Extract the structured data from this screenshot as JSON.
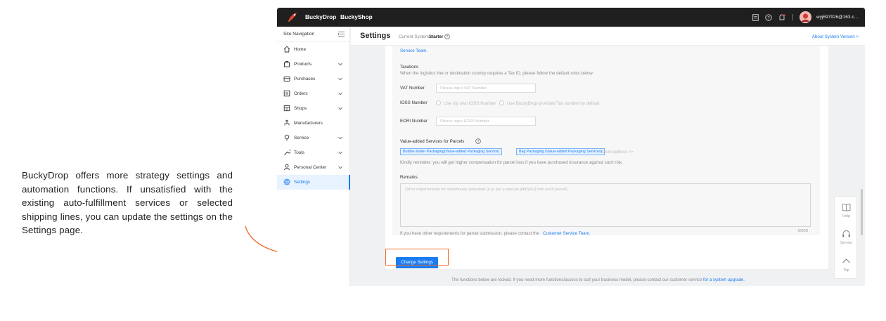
{
  "annotation": {
    "text": "BuckyDrop offers more strategy settings and automation functions. If unsatisfied with the existing auto-fulfillment services or selected shipping lines, you can update the settings on the Settings page.",
    "highlight_color": "#ef6a2a"
  },
  "topbar": {
    "brand": "BuckyDrop",
    "shop": "BuckyShop",
    "icons": [
      "document-icon",
      "help-icon",
      "notification-icon",
      "avatar"
    ],
    "email": "wyj697926@163.c..."
  },
  "sidebar": {
    "title": "Site Navigation",
    "items": [
      {
        "label": "Home",
        "icon": "home-icon",
        "expandable": false
      },
      {
        "label": "Products",
        "icon": "shopping-bag-icon",
        "expandable": true
      },
      {
        "label": "Purchases",
        "icon": "purchase-icon",
        "expandable": true
      },
      {
        "label": "Orders",
        "icon": "orders-icon",
        "expandable": true
      },
      {
        "label": "Shops",
        "icon": "shop-icon",
        "expandable": true
      },
      {
        "label": "Manufacturers",
        "icon": "manufacturer-icon",
        "expandable": false
      },
      {
        "label": "Service",
        "icon": "service-icon",
        "expandable": true
      },
      {
        "label": "Tools",
        "icon": "tools-icon",
        "expandable": true
      },
      {
        "label": "Personal Center",
        "icon": "user-icon",
        "expandable": true
      },
      {
        "label": "Settings",
        "icon": "settings-icon",
        "expandable": false,
        "active": true
      }
    ]
  },
  "header": {
    "title": "Settings",
    "current_system_label": "Current System:",
    "current_system_value": "Starter",
    "about_link": "About System Version >"
  },
  "content": {
    "service_team_top": "Service Team.",
    "taxations_title": "Taxations",
    "taxations_desc": "When the logistics line or destination country requires a Tax ID, please follow the default rules below:",
    "vat_label": "VAT Number",
    "vat_placeholder": "Please input VAT Number",
    "ioss_label": "IOSS Number",
    "ioss_option1": "Use my own IOSS Number",
    "ioss_option2": "Use BuckyDrop-provided Tax number by default",
    "eori_label": "EORI Number",
    "eori_placeholder": "Please input EORI Number",
    "vas_title": "Value-added Services for Parcels",
    "vas_tags": [
      "Bubble Mailer Packaging(Value-added Packaging Service)",
      "Bag Packaging (Value-added Packaging Services)"
    ],
    "vas_more": "More options >>",
    "vas_reminder": "Kindly reminder: you will get higher compensation for parcel loss if you have purchased insurance against such risk.",
    "remarks_title": "Remarks",
    "remarks_placeholder": "Other requirements for warehouse operation (e.g. put a special gift(SKU) into each parcel)",
    "remarks_counter": "0/500",
    "contact_prefix": "If you have other requirements for parcel submission, please contact the",
    "contact_link": "Customer Service Team.",
    "change_button": "Change Settings",
    "footnote_prefix": "The functions below are locked. If you need more functions/access to suit your business model, please contact our customer service",
    "footnote_link": "for a system upgrade."
  },
  "float_panel": [
    {
      "label": "Help",
      "icon": "book-icon"
    },
    {
      "label": "Service",
      "icon": "headset-icon"
    },
    {
      "label": "Top",
      "icon": "chevron-up-icon"
    }
  ],
  "colors": {
    "accent": "#1a7cf0",
    "topbar": "#1f1f1f",
    "annotation": "#ef6a2a"
  }
}
